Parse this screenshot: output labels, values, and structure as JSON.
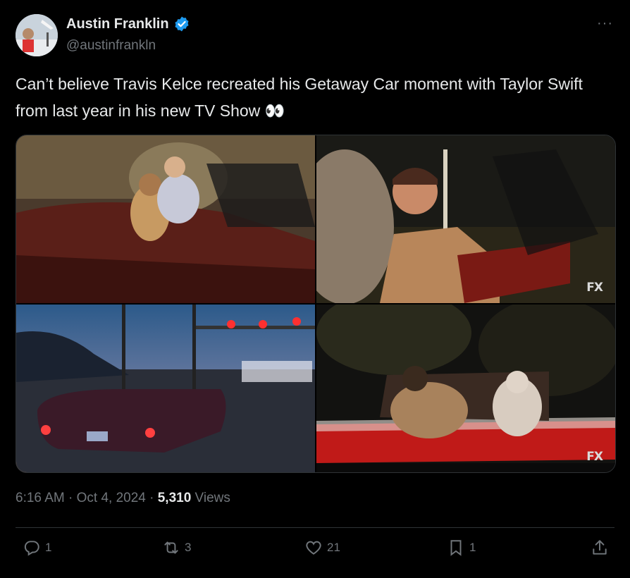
{
  "user": {
    "name": "Austin Franklin",
    "handle": "@austinfrankln"
  },
  "more_label": "···",
  "tweet": {
    "text": "Can’t believe Travis Kelce recreated his Getaway Car moment with Taylor Swift from last year in his new TV Show 👀"
  },
  "media": {
    "watermark": "FX"
  },
  "meta": {
    "time": "6:16 AM",
    "sep1": " · ",
    "date": "Oct 4, 2024",
    "sep2": " · ",
    "views": "5,310",
    "views_label": " Views"
  },
  "actions": {
    "replies": "1",
    "reposts": "3",
    "likes": "21",
    "bookmarks": "1"
  },
  "colors": {
    "background": "#000000",
    "text": "#e7e9ea",
    "muted": "#71767b",
    "verified": "#1d9bf0",
    "divider": "#2f3336"
  }
}
